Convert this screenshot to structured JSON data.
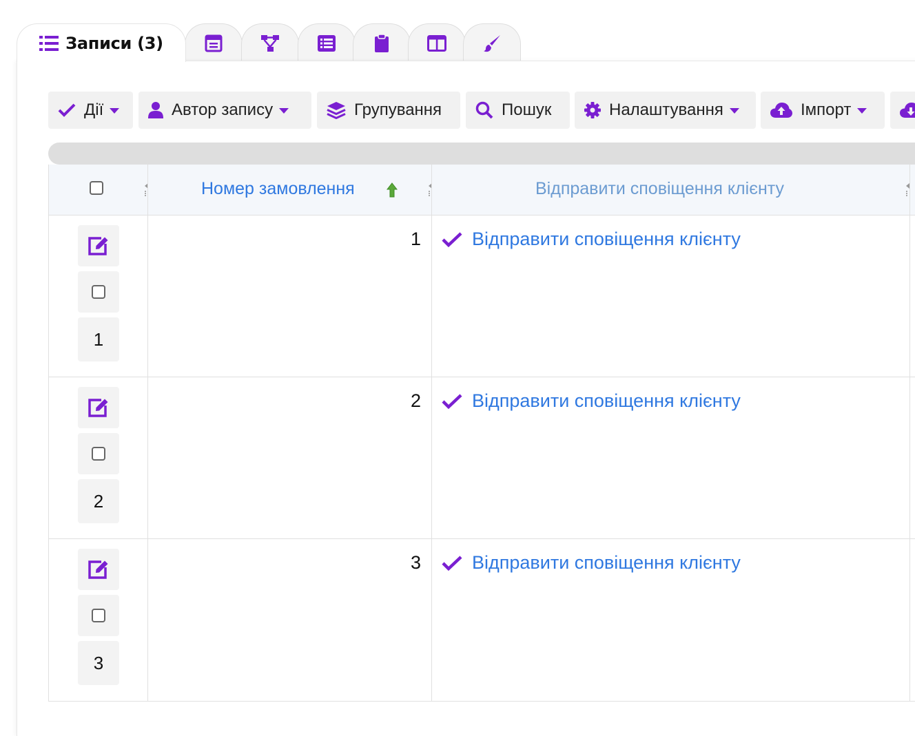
{
  "tabs": [
    {
      "label": "Записи (3)",
      "icon": "list-icon",
      "active": true
    },
    {
      "label": "",
      "icon": "form-icon",
      "active": false
    },
    {
      "label": "",
      "icon": "sitemap-icon",
      "active": false
    },
    {
      "label": "",
      "icon": "list-alt-icon",
      "active": false
    },
    {
      "label": "",
      "icon": "clipboard-icon",
      "active": false
    },
    {
      "label": "",
      "icon": "columns-icon",
      "active": false
    },
    {
      "label": "",
      "icon": "paint-brush-icon",
      "active": false
    }
  ],
  "toolbar": {
    "actions_label": "Дії",
    "author_label": "Автор запису",
    "grouping_label": "Групування",
    "search_label": "Пошук",
    "settings_label": "Налаштування",
    "import_label": "Імпорт"
  },
  "table": {
    "columns": [
      {
        "label": "Номер замовлення",
        "sorted": "asc"
      },
      {
        "label": "Відправити сповіщення клієнту"
      }
    ],
    "rows": [
      {
        "row_number": "1",
        "order_number": "1",
        "action": "Відправити сповіщення клієнту"
      },
      {
        "row_number": "2",
        "order_number": "2",
        "action": "Відправити сповіщення клієнту"
      },
      {
        "row_number": "3",
        "order_number": "3",
        "action": "Відправити сповіщення клієнту"
      }
    ]
  },
  "colors": {
    "accent": "#7a1fd1",
    "link": "#2f78e0",
    "header_muted": "#6b9bd1",
    "sort_arrow": "#5aa83a"
  }
}
